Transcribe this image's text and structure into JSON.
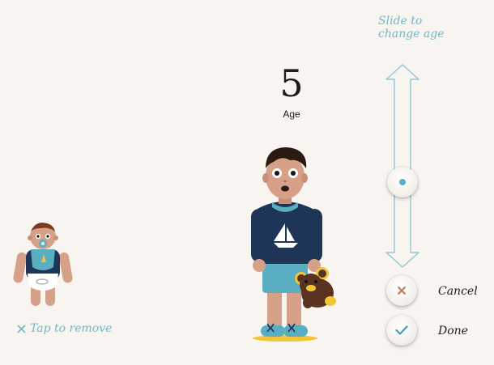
{
  "age": {
    "value": "5",
    "label": "Age"
  },
  "slider": {
    "hint_line1": "Slide to",
    "hint_line2": "change age"
  },
  "actions": {
    "cancel_label": "Cancel",
    "done_label": "Done"
  },
  "family_member": {
    "remove_label": "Tap to remove"
  },
  "colors": {
    "accent": "#6fb8c8",
    "background": "#f8f5f0",
    "shirt": "#1e3557",
    "shorts": "#5aaec2",
    "skin": "#d7a088",
    "hair": "#2b1a12",
    "teddy": "#5a3320"
  },
  "icons": {
    "cancel": "x-mark-icon",
    "done": "check-mark-icon",
    "remove": "close-icon",
    "slider_knob": "slider-dot-icon"
  }
}
